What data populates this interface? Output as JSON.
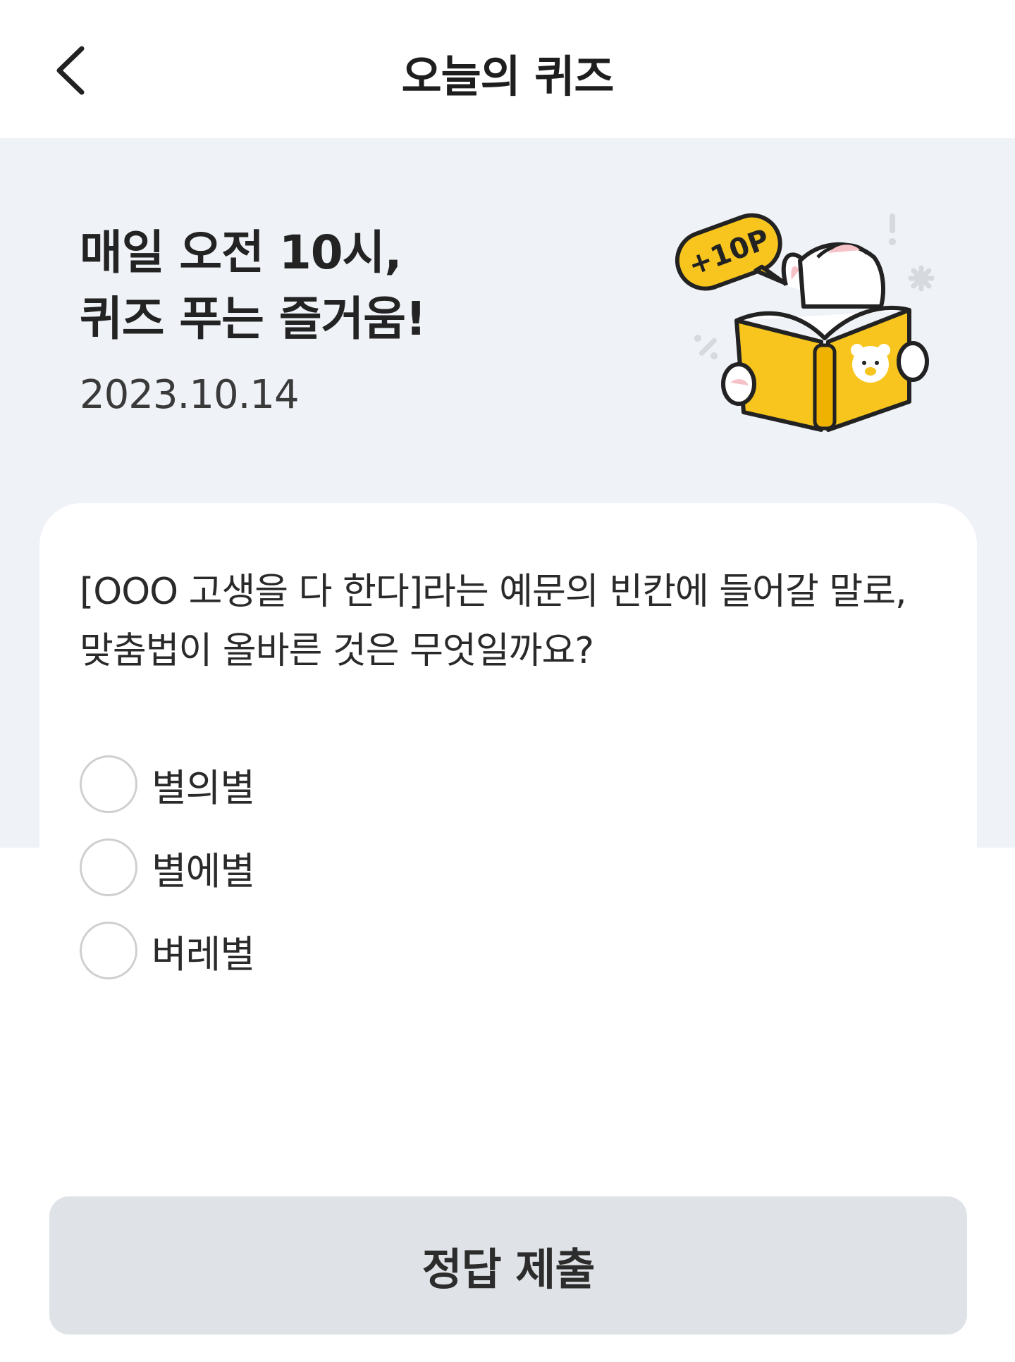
{
  "header": {
    "title": "오늘의 퀴즈",
    "back_icon": "chevron-left-icon"
  },
  "hero": {
    "title_line1": "매일 오전 10시,",
    "title_line2": "퀴즈 푸는 즐거움!",
    "date": "2023.10.14",
    "badge": "+10P",
    "illustration": "rabbit-reading-book",
    "accent_color": "#f7c51e"
  },
  "quiz": {
    "question_line1": "[OOO 고생을 다 한다]라는 예문의 빈칸에 들어갈 말로,",
    "question_line2": "맞춤법이 올바른 것은 무엇일까요?",
    "options": [
      {
        "label": "별의별",
        "selected": false
      },
      {
        "label": "별에별",
        "selected": false
      },
      {
        "label": "벼레별",
        "selected": false
      }
    ]
  },
  "submit": {
    "label": "정답 제출",
    "enabled": false
  },
  "colors": {
    "hero_bg": "#eff2f7",
    "button_disabled_bg": "#dfe2e6"
  }
}
